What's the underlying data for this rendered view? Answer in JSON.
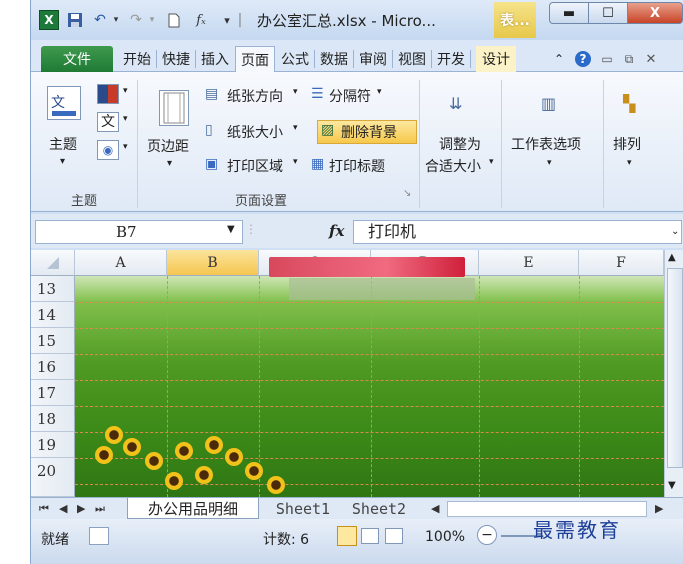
{
  "titlebar": {
    "app_icon": "X",
    "title": "办公室汇总.xlsx - Micro...",
    "context_tab": "表...",
    "min_glyph": "▬",
    "max_glyph": "☐",
    "close_glyph": "X"
  },
  "tabs": [
    "文件",
    "开始",
    "快捷",
    "插入",
    "页面",
    "公式",
    "数据",
    "审阅",
    "视图",
    "开发",
    "设计"
  ],
  "ribbon": {
    "theme_group": {
      "theme_label": "主题",
      "group_label": "主题"
    },
    "page_setup": {
      "margins_label": "页边距",
      "orientation_label": "纸张方向",
      "size_label": "纸张大小",
      "print_area_label": "打印区域",
      "breaks_label": "分隔符",
      "delete_bg_label": "删除背景",
      "print_titles_label": "打印标题",
      "group_label": "页面设置"
    },
    "fit": {
      "line1": "调整为",
      "line2": "合适大小"
    },
    "sheet_options_label": "工作表选项",
    "arrange_label": "排列"
  },
  "formula_bar": {
    "name_box": "B7",
    "fx": "fx",
    "content": "打印机"
  },
  "grid": {
    "columns": [
      "A",
      "B",
      "C",
      "D",
      "E",
      "F"
    ],
    "selected_column": "B",
    "rows": [
      "13",
      "14",
      "15",
      "16",
      "17",
      "18",
      "19",
      "20"
    ]
  },
  "sheets": {
    "active": "办公用品明细",
    "others": [
      "Sheet1",
      "Sheet2"
    ]
  },
  "statusbar": {
    "mode": "就绪",
    "count": "计数: 6",
    "zoom": "100%",
    "zoom_out": "−"
  },
  "watermark": "最需教育"
}
